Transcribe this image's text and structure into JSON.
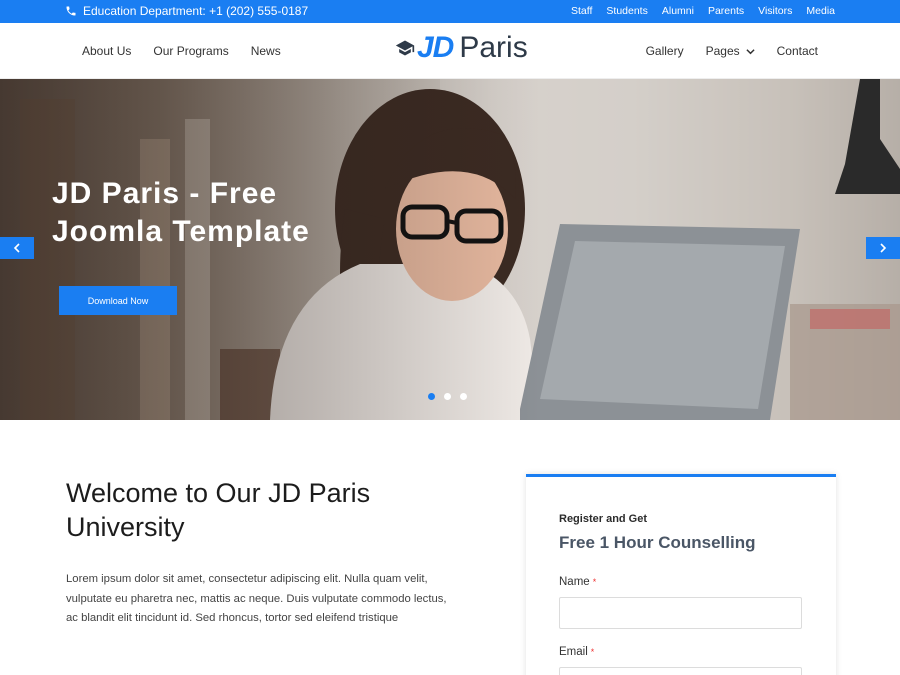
{
  "topbar": {
    "phone_text": "Education Department: +1 (202) 555-0187",
    "links": [
      "Staff",
      "Students",
      "Alumni",
      "Parents",
      "Visitors",
      "Media"
    ]
  },
  "header": {
    "nav_left": [
      "About Us",
      "Our Programs",
      "News"
    ],
    "logo_jd": "JD",
    "logo_paris": "Paris",
    "nav_right": {
      "gallery": "Gallery",
      "pages": "Pages",
      "contact": "Contact"
    }
  },
  "hero": {
    "title_line1": "JD Paris - Free",
    "title_line2": "Joomla Template",
    "button_label": "Download Now",
    "slide_count": 3,
    "active_slide": 1
  },
  "welcome": {
    "title_line1": "Welcome to Our JD Paris",
    "title_line2": "University",
    "body": "Lorem ipsum dolor sit amet, consectetur adipiscing elit. Nulla quam velit, vulputate eu pharetra nec, mattis ac neque. Duis vulputate commodo lectus, ac blandit elit tincidunt id. Sed rhoncus, tortor sed eleifend tristique"
  },
  "form": {
    "pre_title": "Register and Get",
    "title": "Free 1 Hour Counselling",
    "name_label": "Name",
    "email_label": "Email",
    "required_mark": "*"
  },
  "colors": {
    "accent": "#1a7ef2",
    "dark_text": "#2e3a48"
  }
}
